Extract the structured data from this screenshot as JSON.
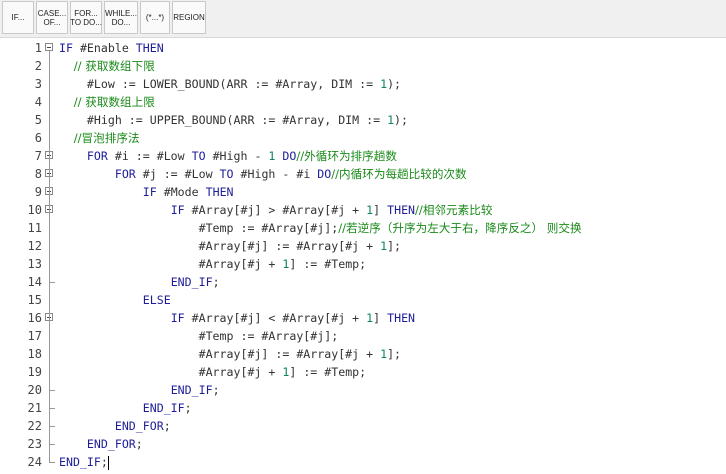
{
  "toolbar": {
    "buttons": [
      {
        "line1": "IF...",
        "line2": ""
      },
      {
        "line1": "CASE...",
        "line2": "OF..."
      },
      {
        "line1": "FOR...",
        "line2": "TO DO..."
      },
      {
        "line1": "WHILE...",
        "line2": "DO..."
      },
      {
        "line1": "(*...*)",
        "line2": ""
      },
      {
        "line1": "REGION",
        "line2": ""
      }
    ]
  },
  "editor": {
    "lines": [
      {
        "n": "1",
        "segs": [
          {
            "t": "IF ",
            "c": "kw"
          },
          {
            "t": "#Enable ",
            "c": ""
          },
          {
            "t": "THEN",
            "c": "kw"
          }
        ]
      },
      {
        "n": "2",
        "segs": [
          {
            "t": "    // 获取数组下限",
            "c": "cm"
          }
        ]
      },
      {
        "n": "3",
        "segs": [
          {
            "t": "    #Low := LOWER_BOUND(ARR := #Array, DIM := ",
            "c": ""
          },
          {
            "t": "1",
            "c": "num"
          },
          {
            "t": ");",
            "c": ""
          }
        ]
      },
      {
        "n": "4",
        "segs": [
          {
            "t": "    // 获取数组上限",
            "c": "cm"
          }
        ]
      },
      {
        "n": "5",
        "segs": [
          {
            "t": "    #High := UPPER_BOUND(ARR := #Array, DIM := ",
            "c": ""
          },
          {
            "t": "1",
            "c": "num"
          },
          {
            "t": ");",
            "c": ""
          }
        ]
      },
      {
        "n": "6",
        "segs": [
          {
            "t": "    //冒泡排序法",
            "c": "cm"
          }
        ]
      },
      {
        "n": "7",
        "segs": [
          {
            "t": "    ",
            "c": ""
          },
          {
            "t": "FOR ",
            "c": "kw"
          },
          {
            "t": "#i := #Low ",
            "c": ""
          },
          {
            "t": "TO ",
            "c": "kw"
          },
          {
            "t": "#High - ",
            "c": ""
          },
          {
            "t": "1 ",
            "c": "num"
          },
          {
            "t": "DO",
            "c": "kw"
          },
          {
            "t": "//外循环为排序趟数",
            "c": "cm"
          }
        ]
      },
      {
        "n": "8",
        "segs": [
          {
            "t": "        ",
            "c": ""
          },
          {
            "t": "FOR ",
            "c": "kw"
          },
          {
            "t": "#j := #Low ",
            "c": ""
          },
          {
            "t": "TO ",
            "c": "kw"
          },
          {
            "t": "#High - #i ",
            "c": ""
          },
          {
            "t": "DO",
            "c": "kw"
          },
          {
            "t": "//内循环为每趟比较的次数",
            "c": "cm"
          }
        ]
      },
      {
        "n": "9",
        "segs": [
          {
            "t": "            ",
            "c": ""
          },
          {
            "t": "IF ",
            "c": "kw"
          },
          {
            "t": "#Mode ",
            "c": ""
          },
          {
            "t": "THEN",
            "c": "kw"
          }
        ]
      },
      {
        "n": "10",
        "segs": [
          {
            "t": "                ",
            "c": ""
          },
          {
            "t": "IF ",
            "c": "kw"
          },
          {
            "t": "#Array[#j] > #Array[#j + ",
            "c": ""
          },
          {
            "t": "1",
            "c": "num"
          },
          {
            "t": "] ",
            "c": ""
          },
          {
            "t": "THEN",
            "c": "kw"
          },
          {
            "t": "//相邻元素比较",
            "c": "cm"
          }
        ]
      },
      {
        "n": "11",
        "segs": [
          {
            "t": "                    #Temp := #Array[#j];",
            "c": ""
          },
          {
            "t": "//若逆序（升序为左大于右，降序反之） 则交换",
            "c": "cm"
          }
        ]
      },
      {
        "n": "12",
        "segs": [
          {
            "t": "                    #Array[#j] := #Array[#j + ",
            "c": ""
          },
          {
            "t": "1",
            "c": "num"
          },
          {
            "t": "];",
            "c": ""
          }
        ]
      },
      {
        "n": "13",
        "segs": [
          {
            "t": "                    #Array[#j + ",
            "c": ""
          },
          {
            "t": "1",
            "c": "num"
          },
          {
            "t": "] := #Temp;",
            "c": ""
          }
        ]
      },
      {
        "n": "14",
        "segs": [
          {
            "t": "                ",
            "c": ""
          },
          {
            "t": "END_IF",
            "c": "kw"
          },
          {
            "t": ";",
            "c": ""
          }
        ]
      },
      {
        "n": "15",
        "segs": [
          {
            "t": "            ",
            "c": ""
          },
          {
            "t": "ELSE",
            "c": "kw"
          }
        ]
      },
      {
        "n": "16",
        "segs": [
          {
            "t": "                ",
            "c": ""
          },
          {
            "t": "IF ",
            "c": "kw"
          },
          {
            "t": "#Array[#j] < #Array[#j + ",
            "c": ""
          },
          {
            "t": "1",
            "c": "num"
          },
          {
            "t": "] ",
            "c": ""
          },
          {
            "t": "THEN",
            "c": "kw"
          }
        ]
      },
      {
        "n": "17",
        "segs": [
          {
            "t": "                    #Temp := #Array[#j];",
            "c": ""
          }
        ]
      },
      {
        "n": "18",
        "segs": [
          {
            "t": "                    #Array[#j] := #Array[#j + ",
            "c": ""
          },
          {
            "t": "1",
            "c": "num"
          },
          {
            "t": "];",
            "c": ""
          }
        ]
      },
      {
        "n": "19",
        "segs": [
          {
            "t": "                    #Array[#j + ",
            "c": ""
          },
          {
            "t": "1",
            "c": "num"
          },
          {
            "t": "] := #Temp;",
            "c": ""
          }
        ]
      },
      {
        "n": "20",
        "segs": [
          {
            "t": "                ",
            "c": ""
          },
          {
            "t": "END_IF",
            "c": "kw"
          },
          {
            "t": ";",
            "c": ""
          }
        ]
      },
      {
        "n": "21",
        "segs": [
          {
            "t": "            ",
            "c": ""
          },
          {
            "t": "END_IF",
            "c": "kw"
          },
          {
            "t": ";",
            "c": ""
          }
        ]
      },
      {
        "n": "22",
        "segs": [
          {
            "t": "        ",
            "c": ""
          },
          {
            "t": "END_FOR",
            "c": "kw"
          },
          {
            "t": ";",
            "c": ""
          }
        ]
      },
      {
        "n": "23",
        "segs": [
          {
            "t": "    ",
            "c": ""
          },
          {
            "t": "END_FOR",
            "c": "kw"
          },
          {
            "t": ";",
            "c": ""
          }
        ]
      },
      {
        "n": "24",
        "segs": [
          {
            "t": "END_IF",
            "c": "kw"
          },
          {
            "t": ";",
            "c": ""
          }
        ]
      }
    ]
  }
}
